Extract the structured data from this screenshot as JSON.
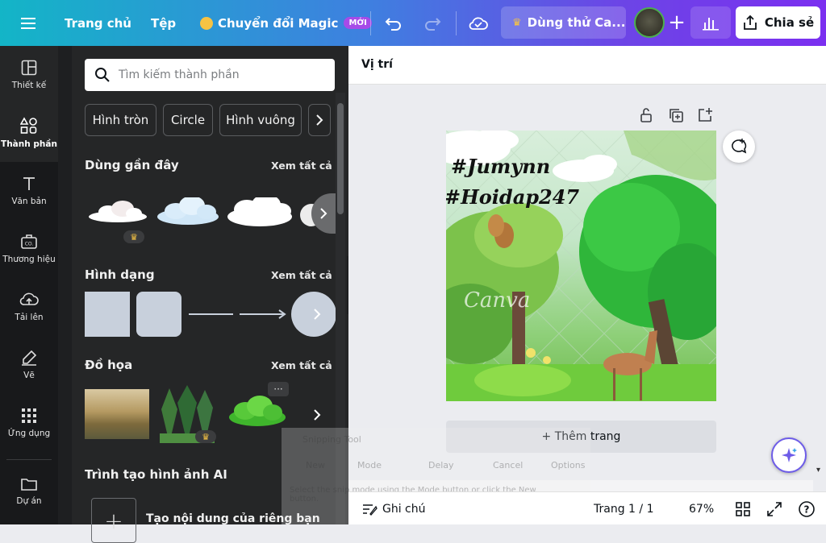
{
  "topbar": {
    "home": "Trang chủ",
    "file": "Tệp",
    "magic": "Chuyển đổi Magic",
    "magic_badge": "MỚI",
    "try": "Dùng thử Ca...",
    "share": "Chia sẻ"
  },
  "rail": {
    "items": [
      {
        "label": "Thiết kế",
        "icon": "layout-icon"
      },
      {
        "label": "Thành phần",
        "icon": "shapes-icon"
      },
      {
        "label": "Văn bản",
        "icon": "text-icon"
      },
      {
        "label": "Thương hiệu",
        "icon": "brand-icon"
      },
      {
        "label": "Tải lên",
        "icon": "cloud-upload-icon"
      },
      {
        "label": "Vẽ",
        "icon": "draw-icon"
      },
      {
        "label": "Ứng dụng",
        "icon": "apps-grid-icon"
      },
      {
        "label": "Dự án",
        "icon": "folder-icon"
      }
    ]
  },
  "panel": {
    "search_placeholder": "Tìm kiếm thành phần",
    "chips": [
      "Hình tròn",
      "Circle",
      "Hình vuông"
    ],
    "sections": {
      "recent": "Dùng gần đây",
      "shapes": "Hình dạng",
      "graphics": "Đồ họa",
      "ai": "Trình tạo hình ảnh AI"
    },
    "see_all": "Xem tất cả",
    "ai_cta": "Tạo nội dung của riêng bạn"
  },
  "subbar": {
    "label": "Vị trí"
  },
  "canvas": {
    "add_page": "+ Thêm trang",
    "design_text": [
      "#Jumynn",
      "#Hoidap247"
    ],
    "watermark": "Canva"
  },
  "footer": {
    "notes": "Ghi chú",
    "page": "Trang 1 / 1",
    "zoom": "67%"
  },
  "snipping": {
    "title": "Snipping Tool",
    "buttons": [
      "New",
      "Mode",
      "Delay",
      "Cancel",
      "Options"
    ],
    "hint": "Select the snip mode using the Mode button or click the New button."
  },
  "colors": {
    "accent": "#7b2ff0",
    "teal": "#13b5c7",
    "panel": "#252627"
  }
}
